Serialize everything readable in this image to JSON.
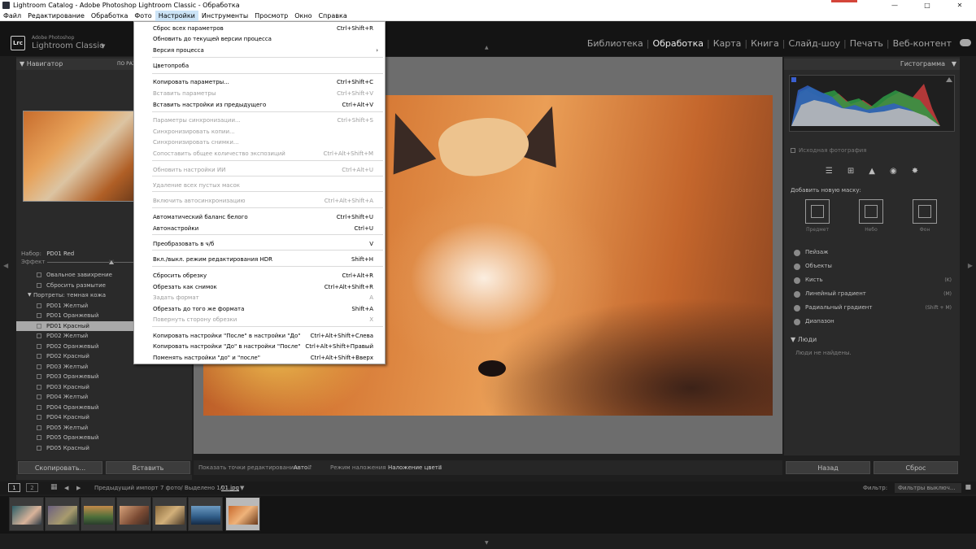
{
  "window": {
    "title": "Lightroom Catalog - Adobe Photoshop Lightroom Classic - Обработка"
  },
  "menubar": [
    "Файл",
    "Редактирование",
    "Обработка",
    "Фото",
    "Настройки",
    "Инструменты",
    "Просмотр",
    "Окно",
    "Справка"
  ],
  "header": {
    "logo": "Lrc",
    "brand_small": "Adobe Photoshop",
    "brand": "Lightroom Classic",
    "modules": [
      "Библиотека",
      "Обработка",
      "Карта",
      "Книга",
      "Слайд-шоу",
      "Печать",
      "Веб-контент"
    ],
    "active_module": "Обработка"
  },
  "left": {
    "navigator_title": "Навигатор",
    "navigator_fit": "ПО РАЗ",
    "set_label": "Набор:",
    "set_value": "PD01 Red",
    "effect_label": "Эффект",
    "presets": [
      {
        "label": "Овальное завихрение",
        "group": false
      },
      {
        "label": "Сбросить размытие",
        "group": false
      },
      {
        "label": "Портреты: темная кожа",
        "group": true
      },
      {
        "label": "PD01 Желтый",
        "group": false
      },
      {
        "label": "PD01 Оранжевый",
        "group": false
      },
      {
        "label": "PD01 Красный",
        "group": false,
        "selected": true
      },
      {
        "label": "PD02 Желтый",
        "group": false
      },
      {
        "label": "PD02 Оранжевый",
        "group": false
      },
      {
        "label": "PD02 Красный",
        "group": false
      },
      {
        "label": "PD03 Желтый",
        "group": false
      },
      {
        "label": "PD03 Оранжевый",
        "group": false
      },
      {
        "label": "PD03 Красный",
        "group": false
      },
      {
        "label": "PD04 Желтый",
        "group": false
      },
      {
        "label": "PD04 Оранжевый",
        "group": false
      },
      {
        "label": "PD04 Красный",
        "group": false
      },
      {
        "label": "PD05 Желтый",
        "group": false
      },
      {
        "label": "PD05 Оранжевый",
        "group": false
      },
      {
        "label": "PD05 Красный",
        "group": false
      }
    ],
    "copy_button": "Скопировать...",
    "paste_button": "Вставить"
  },
  "toolbar": {
    "edit_points_label": "Показать точки редактирования",
    "edit_points_value": "Авто",
    "blend_label": "Режим наложения",
    "blend_value": "Наложение цвета"
  },
  "right": {
    "histogram_title": "Гистограмма",
    "original_photo": "Исходная фотография",
    "add_mask": "Добавить новую маску:",
    "mask_buttons": [
      "Предмет",
      "Небо",
      "Фон"
    ],
    "mask_items": [
      {
        "label": "Пейзаж",
        "shortcut": ""
      },
      {
        "label": "Объекты",
        "shortcut": ""
      },
      {
        "label": "Кисть",
        "shortcut": "(K)"
      },
      {
        "label": "Линейный градиент",
        "shortcut": "(M)"
      },
      {
        "label": "Радиальный градиент",
        "shortcut": "(Shift + M)"
      },
      {
        "label": "Диапазон",
        "shortcut": ""
      }
    ],
    "people_title": "Люди",
    "no_people": "Люди не найдены.",
    "back_button": "Назад",
    "reset_button": "Сброс"
  },
  "filmbar": {
    "page1": "1",
    "page2": "2",
    "source": "Предыдущий импорт",
    "count": "7 фото/ Выделено 1/",
    "filename": "01.jpg",
    "filter_label": "Фильтр:",
    "filter_value": "Фильтры выключ..."
  },
  "menu": {
    "items": [
      {
        "label": "Сброс всех параметров",
        "shortcut": "Ctrl+Shift+R",
        "disabled": false
      },
      {
        "label": "Обновить до текущей версии процесса",
        "shortcut": "",
        "disabled": false
      },
      {
        "label": "Версия процесса",
        "shortcut": "",
        "disabled": false,
        "submenu": true
      },
      {
        "label": "Цветопроба",
        "shortcut": "",
        "disabled": false
      },
      {
        "label": "Копировать параметры...",
        "shortcut": "Ctrl+Shift+C",
        "disabled": false
      },
      {
        "label": "Вставить параметры",
        "shortcut": "Ctrl+Shift+V",
        "disabled": true
      },
      {
        "label": "Вставить настройки из предыдущего",
        "shortcut": "Ctrl+Alt+V",
        "disabled": false
      },
      {
        "label": "Параметры синхронизации...",
        "shortcut": "Ctrl+Shift+S",
        "disabled": true
      },
      {
        "label": "Синхронизировать копии...",
        "shortcut": "",
        "disabled": true
      },
      {
        "label": "Синхронизировать снимки...",
        "shortcut": "",
        "disabled": true
      },
      {
        "label": "Сопоставить общее количество экспозиций",
        "shortcut": "Ctrl+Alt+Shift+M",
        "disabled": true
      },
      {
        "label": "Обновить настройки ИИ",
        "shortcut": "Ctrl+Alt+U",
        "disabled": true
      },
      {
        "label": "Удаление всех пустых масок",
        "shortcut": "",
        "disabled": true
      },
      {
        "label": "Включить автосинхронизацию",
        "shortcut": "Ctrl+Alt+Shift+A",
        "disabled": true
      },
      {
        "label": "Автоматический баланс белого",
        "shortcut": "Ctrl+Shift+U",
        "disabled": false
      },
      {
        "label": "Автонастройки",
        "shortcut": "Ctrl+U",
        "disabled": false
      },
      {
        "label": "Преобразовать в ч/б",
        "shortcut": "V",
        "disabled": false
      },
      {
        "label": "Вкл./выкл. режим редактирования HDR",
        "shortcut": "Shift+H",
        "disabled": false
      },
      {
        "label": "Сбросить обрезку",
        "shortcut": "Ctrl+Alt+R",
        "disabled": false
      },
      {
        "label": "Обрезать как снимок",
        "shortcut": "Ctrl+Alt+Shift+R",
        "disabled": false
      },
      {
        "label": "Задать формат",
        "shortcut": "A",
        "disabled": true
      },
      {
        "label": "Обрезать до того же формата",
        "shortcut": "Shift+A",
        "disabled": false
      },
      {
        "label": "Повернуть сторону обрезки",
        "shortcut": "X",
        "disabled": true
      },
      {
        "label": "Копировать настройки \"После\" в настройки \"До\"",
        "shortcut": "Ctrl+Alt+Shift+Слева",
        "disabled": false
      },
      {
        "label": "Копировать настройки \"До\" в настройки \"После\"",
        "shortcut": "Ctrl+Alt+Shift+Правый",
        "disabled": false
      },
      {
        "label": "Поменять настройки \"до\" и \"после\"",
        "shortcut": "Ctrl+Alt+Shift+Вверх",
        "disabled": false
      }
    ]
  },
  "colors": {
    "accent": "#cce4f7",
    "panel": "#2a2a2a",
    "selected_preset": "#a9a9a9"
  },
  "icons": [
    "minimize-icon",
    "maximize-icon",
    "close-icon",
    "cloud-icon",
    "settings-sliders-icon",
    "crop-icon",
    "eraser-icon",
    "red-eye-icon",
    "masking-icon"
  ]
}
